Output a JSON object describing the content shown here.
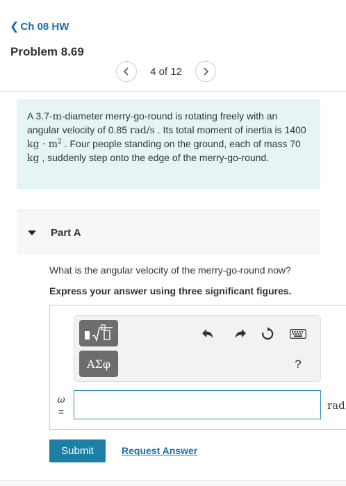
{
  "nav": {
    "back_label": "Ch 08 HW"
  },
  "problem": {
    "title": "Problem 8.69"
  },
  "pager": {
    "status": "4 of 12"
  },
  "statement": {
    "t1": "A 3.7-",
    "m1": "m",
    "t2": "-diameter merry-go-round is rotating freely with an angular velocity of 0.85 ",
    "m2": "rad/s",
    "t3": " . Its total moment of inertia is 1400 ",
    "m3": "kg · m",
    "m3_exp": "2",
    "t4": " . Four people standing on the ground, each of mass 70 ",
    "m4": "kg",
    "t5": " , suddenly step onto the edge of the merry-go-round."
  },
  "part": {
    "label": "Part A",
    "question": "What is the angular velocity of the merry-go-round now?",
    "instruction": "Express your answer using three significant figures."
  },
  "toolbar": {
    "symbols_label": "ΑΣφ",
    "help_label": "?"
  },
  "answer": {
    "variable": "ω",
    "equals": "=",
    "value": "",
    "unit": "rad"
  },
  "actions": {
    "submit_label": "Submit",
    "request_label": "Request Answer"
  },
  "colors": {
    "link": "#1a6ea6",
    "submit": "#1c7fa6",
    "problem_bg": "#e6f4f5",
    "input_border": "#2e8ab8"
  }
}
